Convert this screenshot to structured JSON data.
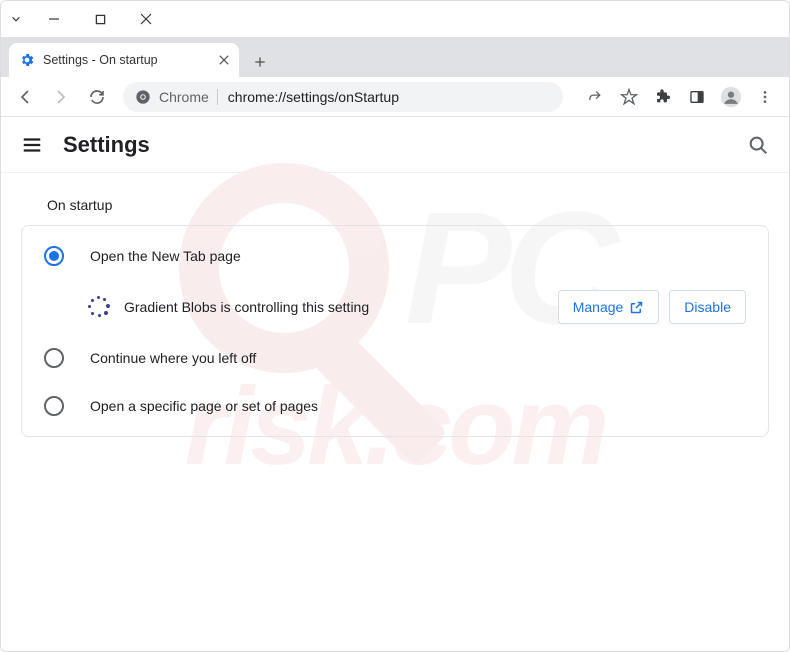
{
  "window": {
    "tab_title": "Settings - On startup"
  },
  "omnibox": {
    "site_label": "Chrome",
    "url": "chrome://settings/onStartup"
  },
  "header": {
    "title": "Settings"
  },
  "startup": {
    "section_title": "On startup",
    "options": [
      {
        "label": "Open the New Tab page",
        "selected": true
      },
      {
        "label": "Continue where you left off",
        "selected": false
      },
      {
        "label": "Open a specific page or set of pages",
        "selected": false
      }
    ],
    "controlled_by_text": "Gradient Blobs is controlling this setting",
    "manage_label": "Manage",
    "disable_label": "Disable"
  },
  "watermark": {
    "pc": "PC",
    "risk": "risk.com"
  }
}
